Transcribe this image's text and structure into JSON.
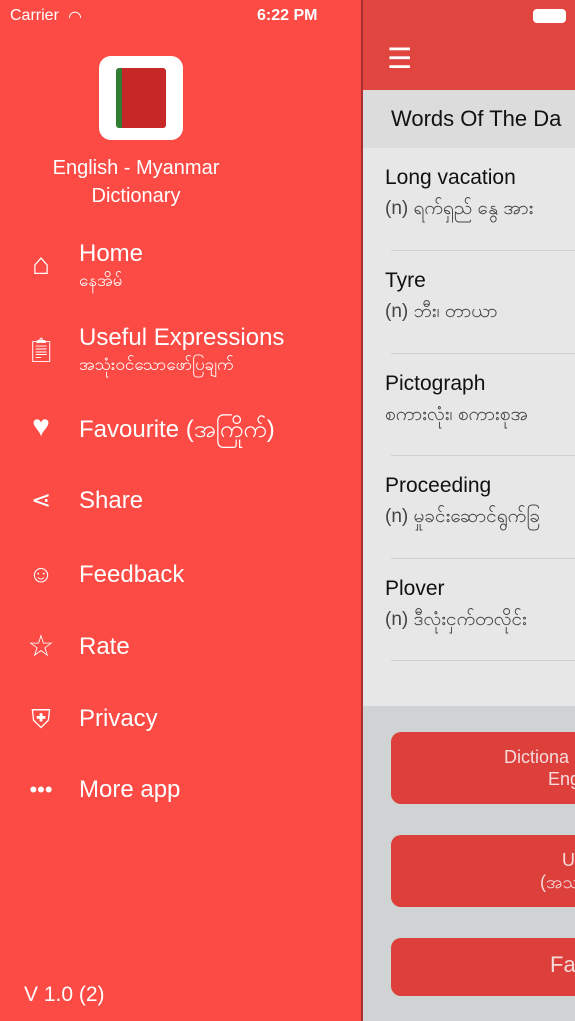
{
  "status_bar": {
    "carrier": "Carrier",
    "time": "6:22 PM"
  },
  "drawer": {
    "app_title": "English - Myanmar Dictionary",
    "items": [
      {
        "icon": "home-icon",
        "label": "Home",
        "sub": "နေအိမ်"
      },
      {
        "icon": "clipboard-icon",
        "label": "Useful Expressions",
        "sub": "အသုံးဝင်သောဖော်ပြချက်"
      },
      {
        "icon": "heart-icon",
        "label": "Favourite (အကြိုက်)"
      },
      {
        "icon": "share-icon",
        "label": "Share"
      },
      {
        "icon": "feedback-icon",
        "label": "Feedback"
      },
      {
        "icon": "star-icon",
        "label": "Rate"
      },
      {
        "icon": "shield-lock-icon",
        "label": "Privacy"
      },
      {
        "icon": "more-dots-icon",
        "label": "More app"
      }
    ],
    "version": "V 1.0 (2)"
  },
  "main": {
    "section_title": "Words Of The Da",
    "words": [
      {
        "word": "Long vacation",
        "def": "(n) ရက်ရှည် နွေ အား"
      },
      {
        "word": "Tyre",
        "def": "(n) ဘီး၊ တာယာ"
      },
      {
        "word": "Pictograph",
        "def": "စကားလုံး၊ စကားစုအ"
      },
      {
        "word": "Proceeding",
        "def": "(n) မှုခင်းဆောင်ရွက်ခြ"
      },
      {
        "word": "Plover",
        "def": "(n) ဒီလုံးငှက်တလိုင်း"
      }
    ],
    "buttons": [
      {
        "line1": "Dictiona",
        "line2": "Eng"
      },
      {
        "line1": "U",
        "line2": "(အသ"
      },
      {
        "line1": "Fa"
      }
    ]
  },
  "colors": {
    "drawer": "#fc4a45",
    "navbar": "#e04540",
    "button": "#dd3f3b"
  }
}
